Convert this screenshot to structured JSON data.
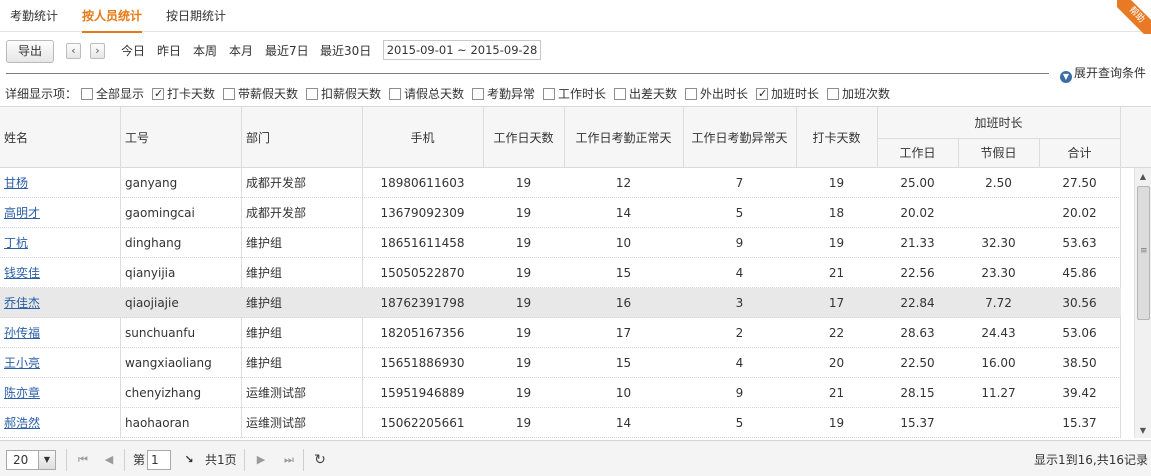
{
  "tabs": [
    "考勤统计",
    "按人员统计",
    "按日期统计"
  ],
  "toolbar": {
    "export_label": "导出",
    "prev": "‹",
    "next": "›",
    "quick": [
      "今日",
      "昨日",
      "本周",
      "本月",
      "最近7日",
      "最近30日"
    ],
    "date_range": "2015-09-01 ~ 2015-09-28",
    "corner_badge": "帮助",
    "expand_label": "展开查询条件"
  },
  "options": {
    "label": "详细显示项：",
    "items": [
      {
        "label": "全部显示",
        "checked": false
      },
      {
        "label": "打卡天数",
        "checked": true
      },
      {
        "label": "带薪假天数",
        "checked": false
      },
      {
        "label": "扣薪假天数",
        "checked": false
      },
      {
        "label": "请假总天数",
        "checked": false
      },
      {
        "label": "考勤异常",
        "checked": false
      },
      {
        "label": "工作时长",
        "checked": false
      },
      {
        "label": "出差天数",
        "checked": false
      },
      {
        "label": "外出时长",
        "checked": false
      },
      {
        "label": "加班时长",
        "checked": true
      },
      {
        "label": "加班次数",
        "checked": false
      }
    ]
  },
  "table": {
    "headers": {
      "name": "姓名",
      "id": "工号",
      "dept": "部门",
      "phone": "手机",
      "workdays": "工作日天数",
      "normal": "工作日考勤正常天",
      "abnormal": "工作日考勤异常天",
      "punch": "打卡天数",
      "overtime_group": "加班时长",
      "ot_workday": "工作日",
      "ot_holiday": "节假日",
      "ot_total": "合计"
    },
    "rows": [
      {
        "name": "甘杨",
        "id": "ganyang",
        "dept": "成都开发部",
        "phone": "18980611603",
        "workdays": "19",
        "normal": "12",
        "abnormal": "7",
        "punch": "19",
        "ot_workday": "25.00",
        "ot_holiday": "2.50",
        "ot_total": "27.50"
      },
      {
        "name": "高明才",
        "id": "gaomingcai",
        "dept": "成都开发部",
        "phone": "13679092309",
        "workdays": "19",
        "normal": "14",
        "abnormal": "5",
        "punch": "18",
        "ot_workday": "20.02",
        "ot_holiday": "",
        "ot_total": "20.02"
      },
      {
        "name": "丁杭",
        "id": "dinghang",
        "dept": "维护组",
        "phone": "18651611458",
        "workdays": "19",
        "normal": "10",
        "abnormal": "9",
        "punch": "19",
        "ot_workday": "21.33",
        "ot_holiday": "32.30",
        "ot_total": "53.63"
      },
      {
        "name": "钱奕佳",
        "id": "qianyijia",
        "dept": "维护组",
        "phone": "15050522870",
        "workdays": "19",
        "normal": "15",
        "abnormal": "4",
        "punch": "21",
        "ot_workday": "22.56",
        "ot_holiday": "23.30",
        "ot_total": "45.86"
      },
      {
        "name": "乔佳杰",
        "id": "qiaojiajie",
        "dept": "维护组",
        "phone": "18762391798",
        "workdays": "19",
        "normal": "16",
        "abnormal": "3",
        "punch": "17",
        "ot_workday": "22.84",
        "ot_holiday": "7.72",
        "ot_total": "30.56"
      },
      {
        "name": "孙传福",
        "id": "sunchuanfu",
        "dept": "维护组",
        "phone": "18205167356",
        "workdays": "19",
        "normal": "17",
        "abnormal": "2",
        "punch": "22",
        "ot_workday": "28.63",
        "ot_holiday": "24.43",
        "ot_total": "53.06"
      },
      {
        "name": "王小亮",
        "id": "wangxiaoliang",
        "dept": "维护组",
        "phone": "15651886930",
        "workdays": "19",
        "normal": "15",
        "abnormal": "4",
        "punch": "20",
        "ot_workday": "22.50",
        "ot_holiday": "16.00",
        "ot_total": "38.50"
      },
      {
        "name": "陈亦章",
        "id": "chenyizhang",
        "dept": "运维测试部",
        "phone": "15951946889",
        "workdays": "19",
        "normal": "10",
        "abnormal": "9",
        "punch": "21",
        "ot_workday": "28.15",
        "ot_holiday": "11.27",
        "ot_total": "39.42"
      },
      {
        "name": "郝浩然",
        "id": "haohaoran",
        "dept": "运维测试部",
        "phone": "15062205661",
        "workdays": "19",
        "normal": "14",
        "abnormal": "5",
        "punch": "19",
        "ot_workday": "15.37",
        "ot_holiday": "",
        "ot_total": "15.37"
      }
    ]
  },
  "pager": {
    "page_size": "20",
    "page_prefix": "第",
    "page_current": "1",
    "page_total": "共1页",
    "summary": "显示1到16,共16记录"
  },
  "colors": {
    "accent": "#e57a14",
    "link": "#2a5fa6",
    "highlight_row": "#e8e8e8"
  },
  "icons": {
    "first": "first-page-icon",
    "prev": "prev-page-icon",
    "next": "next-page-icon",
    "last": "last-page-icon",
    "go": "go-arrow-icon",
    "refresh": "refresh-icon",
    "expand": "expand-down-icon"
  }
}
